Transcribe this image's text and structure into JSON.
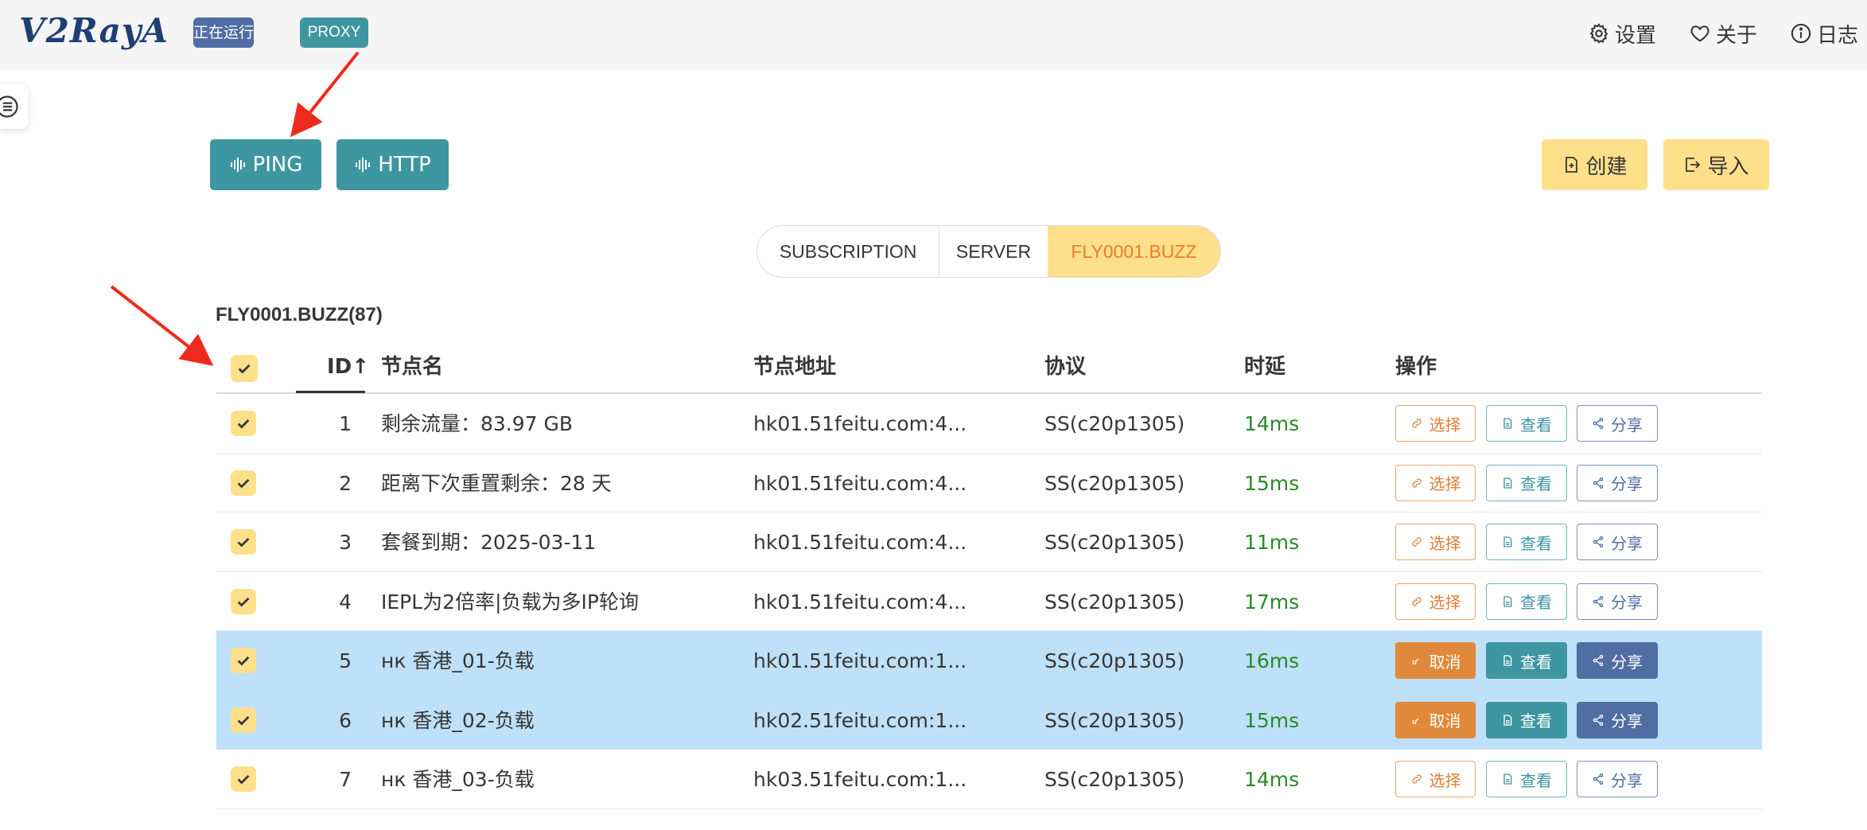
{
  "header": {
    "logo": "V2RayA",
    "status_tag": "正在运行",
    "mode_tag": "PROXY",
    "nav": [
      {
        "icon": "gear-icon",
        "label": "设置"
      },
      {
        "icon": "heart-icon",
        "label": "关于"
      },
      {
        "icon": "info-icon",
        "label": "日志"
      }
    ]
  },
  "toolbar": {
    "ping_label": "PING",
    "http_label": "HTTP",
    "create_label": "创建",
    "import_label": "导入"
  },
  "tabs": [
    "SUBSCRIPTION",
    "SERVER",
    "FLY0001.BUZZ"
  ],
  "active_tab": "FLY0001.BUZZ",
  "group_title": "FLY0001.BUZZ(87)",
  "table": {
    "columns": {
      "id": "ID",
      "name": "节点名",
      "address": "节点地址",
      "protocol": "协议",
      "latency": "时延",
      "actions": "操作"
    },
    "sort_indicator": "↑",
    "rows": [
      {
        "id": "1",
        "name": "剩余流量：83.97 GB",
        "address": "hk01.51feitu.com:4...",
        "protocol": "SS(c20p1305)",
        "latency": "14ms",
        "selected": false,
        "action1": "选择",
        "action2": "查看",
        "action3": "分享"
      },
      {
        "id": "2",
        "name": "距离下次重置剩余：28 天",
        "address": "hk01.51feitu.com:4...",
        "protocol": "SS(c20p1305)",
        "latency": "15ms",
        "selected": false,
        "action1": "选择",
        "action2": "查看",
        "action3": "分享"
      },
      {
        "id": "3",
        "name": "套餐到期：2025-03-11",
        "address": "hk01.51feitu.com:4...",
        "protocol": "SS(c20p1305)",
        "latency": "11ms",
        "selected": false,
        "action1": "选择",
        "action2": "查看",
        "action3": "分享"
      },
      {
        "id": "4",
        "name": "IEPL为2倍率|负载为多IP轮询",
        "address": "hk01.51feitu.com:4...",
        "protocol": "SS(c20p1305)",
        "latency": "17ms",
        "selected": false,
        "action1": "选择",
        "action2": "查看",
        "action3": "分享"
      },
      {
        "id": "5",
        "name": "нк 香港_01-负载",
        "address": "hk01.51feitu.com:1...",
        "protocol": "SS(c20p1305)",
        "latency": "16ms",
        "selected": true,
        "action1": "取消",
        "action2": "查看",
        "action3": "分享"
      },
      {
        "id": "6",
        "name": "нк 香港_02-负载",
        "address": "hk02.51feitu.com:1...",
        "protocol": "SS(c20p1305)",
        "latency": "15ms",
        "selected": true,
        "action1": "取消",
        "action2": "查看",
        "action3": "分享"
      },
      {
        "id": "7",
        "name": "нк 香港_03-负载",
        "address": "hk03.51feitu.com:1...",
        "protocol": "SS(c20p1305)",
        "latency": "14ms",
        "selected": false,
        "action1": "选择",
        "action2": "查看",
        "action3": "分享"
      }
    ]
  },
  "colors": {
    "teal": "#3e96a1",
    "yellow": "#ffe08a",
    "selected_row": "#bee0f8",
    "latency_green": "#288a28",
    "annotation_arrow": "#ee2a1e"
  }
}
